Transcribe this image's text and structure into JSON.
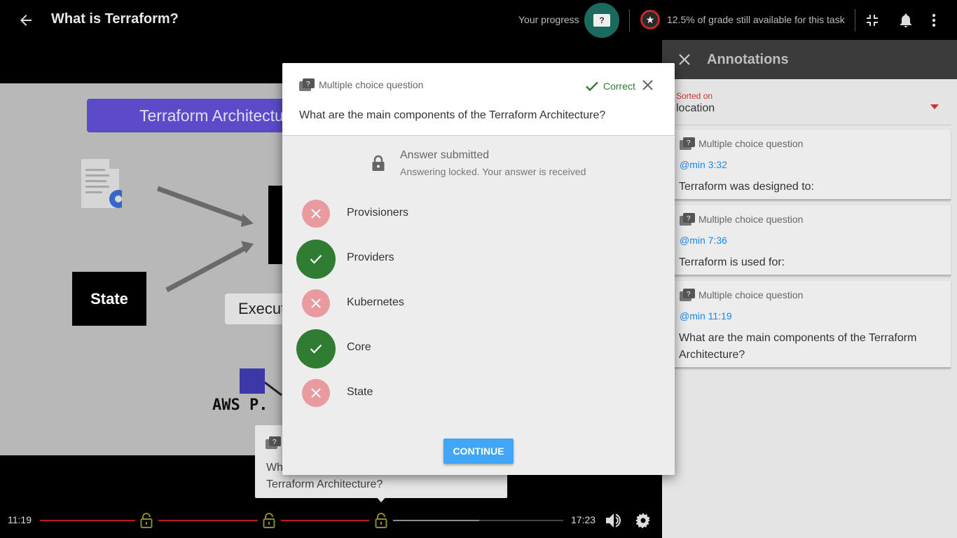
{
  "header": {
    "title": "What is Terraform?",
    "progress_label": "Your progress",
    "progress_badge": "?",
    "grade_text": "12.5% of grade still available for this task"
  },
  "video": {
    "slide_title": "Terraform Architecture",
    "state_label": "State",
    "exec_label": "Execution",
    "aws_label": "AWS P."
  },
  "tooltip": {
    "text": "What are the main components of the Terraform Architecture?"
  },
  "player": {
    "current_time": "11:19",
    "total_time": "17:23"
  },
  "annotations": {
    "title": "Annotations",
    "sort_label": "Sorted on",
    "sort_value": "location",
    "items": [
      {
        "type": "Multiple choice question",
        "time": "@min 3:32",
        "text": "Terraform was designed to:"
      },
      {
        "type": "Multiple choice question",
        "time": "@min 7:36",
        "text": "Terraform is used for:"
      },
      {
        "type": "Multiple choice question",
        "time": "@min 11:19",
        "text": "What are the main components of the Terraform Architecture?"
      }
    ]
  },
  "modal": {
    "type_label": "Multiple choice question",
    "status": "Correct",
    "question": "What are the main components of the Terraform Architecture?",
    "submitted_title": "Answer submitted",
    "submitted_sub": "Answering locked. Your answer is received",
    "answers": [
      {
        "label": "Provisioners",
        "correct": false
      },
      {
        "label": "Providers",
        "correct": true
      },
      {
        "label": "Kubernetes",
        "correct": false
      },
      {
        "label": "Core",
        "correct": true
      },
      {
        "label": "State",
        "correct": false
      }
    ],
    "continue_label": "CONTINUE"
  },
  "colors": {
    "accent_red": "#c62828",
    "correct_green": "#2e7d32",
    "wrong_pink": "#e89a9f",
    "link_blue": "#1e88e5",
    "button_blue": "#42a5f5"
  }
}
